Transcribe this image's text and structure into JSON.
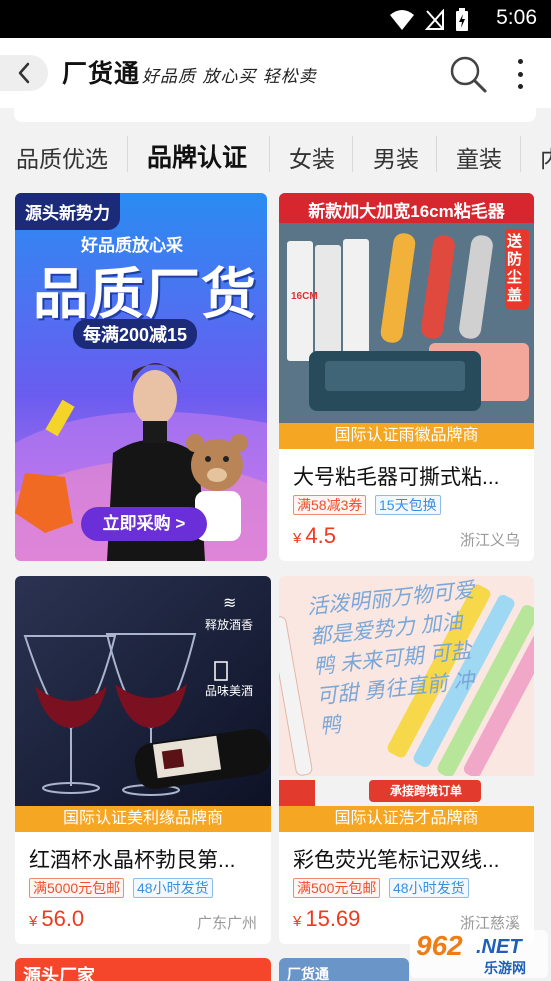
{
  "status": {
    "time": "5:06"
  },
  "header": {
    "brand": "厂货通",
    "slogan": "好品质 放心买 轻松卖"
  },
  "tabs": [
    "品质优选",
    "品牌认证",
    "女装",
    "男装",
    "童装",
    "内"
  ],
  "active_tab_index": 1,
  "colors": {
    "accent": "#ee3a1e",
    "ribbon": "#f5a623",
    "tag_red": "#ef4e2c",
    "tag_blue": "#3b8fe0"
  },
  "banner": {
    "badge": "源头新势力",
    "tagline": "好品质放心采",
    "headline": "品质厂货",
    "promo": "每满200减15",
    "cta": "立即采购 >"
  },
  "products": [
    {
      "image_headline": "新款加大加宽16cm粘毛器",
      "image_badge": "送防尘盖",
      "image_label": "16CM",
      "brand_ribbon": "国际认证雨徽品牌商",
      "title": "大号粘毛器可撕式粘...",
      "tags": [
        {
          "text": "满58减3券",
          "style": "red"
        },
        {
          "text": "15天包换",
          "style": "blue"
        }
      ],
      "price": "4.5",
      "currency": "¥",
      "location": "浙江义乌"
    },
    {
      "image_text_1": "释放酒香",
      "image_text_2": "品味美酒",
      "brand_ribbon": "国际认证美利缘品牌商",
      "title": "红酒杯水晶杯勃艮第...",
      "tags": [
        {
          "text": "满5000元包邮",
          "style": "red"
        },
        {
          "text": "48小时发货",
          "style": "blue"
        }
      ],
      "price": "56.0",
      "currency": "¥",
      "location": "广东广州"
    },
    {
      "image_text": "活泼明丽万物可爱 都是爱势力 加油鸭 未来可期 可盐可甜 勇往直前 冲鸭",
      "image_banner": "承接跨境订单",
      "brand_ribbon": "国际认证浩才品牌商",
      "title": "彩色荧光笔标记双线...",
      "tags": [
        {
          "text": "满500元包邮",
          "style": "red"
        },
        {
          "text": "48小时发货",
          "style": "blue"
        }
      ],
      "price": "15.69",
      "currency": "¥",
      "location": "浙江慈溪"
    }
  ],
  "next_row": {
    "left_peek": "源头厂家",
    "right_peek": "厂货通"
  },
  "watermark": {
    "number": "962",
    "suffix": ".NET",
    "sub": "乐游网"
  }
}
